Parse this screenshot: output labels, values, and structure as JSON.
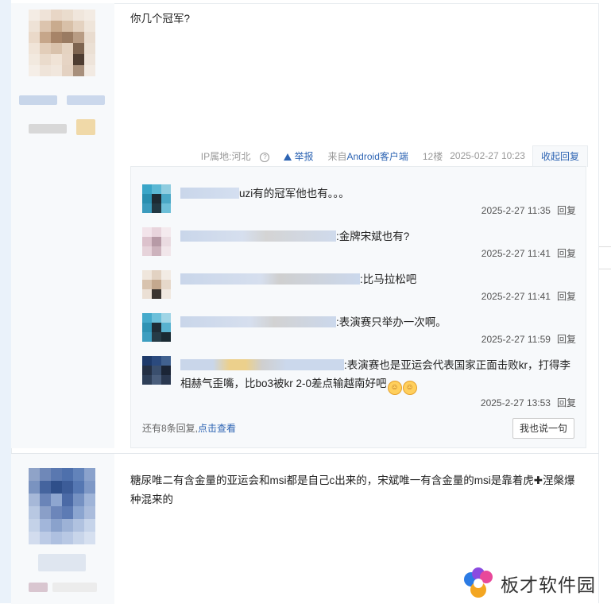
{
  "post1": {
    "content": "你几个冠军?",
    "tail": {
      "ip": "IP属地:河北",
      "report": "举报",
      "source": "来自Android客户端",
      "floor": "12楼",
      "datetime": "2025-02-27 10:23",
      "collapse": "收起回复"
    },
    "replies": [
      {
        "text": "uzi有的冠军他也有。。。",
        "time": "2025-2-27 11:35",
        "reply": "回复"
      },
      {
        "text": ":金牌宋斌也有?",
        "time": "2025-2-27 11:41",
        "reply": "回复"
      },
      {
        "text": ":比马拉松吧",
        "time": "2025-2-27 11:41",
        "reply": "回复"
      },
      {
        "text": ":表演赛只举办一次啊。",
        "time": "2025-2-27 11:59",
        "reply": "回复"
      },
      {
        "text": ":表演赛也是亚运会代表国家正面击败kr，打得李相赫气歪嘴，比bo3被kr 2-0差点输越南好吧",
        "time": "2025-2-27 13:53",
        "reply": "回复"
      }
    ],
    "more": {
      "prefix": "还有8条回复,",
      "link": "点击查看"
    },
    "say_button": "我也说一句"
  },
  "post2": {
    "content": "糖尿唯二有含金量的亚运会和msi都是自己c出来的，宋斌唯一有含金量的msi是靠着虎✚涅槃爆种混来的"
  },
  "watermark": {
    "text": "板才软件园"
  },
  "colors": {
    "link": "#2d64b3",
    "panel": "#f7f9fb",
    "border": "#e8ecef"
  }
}
